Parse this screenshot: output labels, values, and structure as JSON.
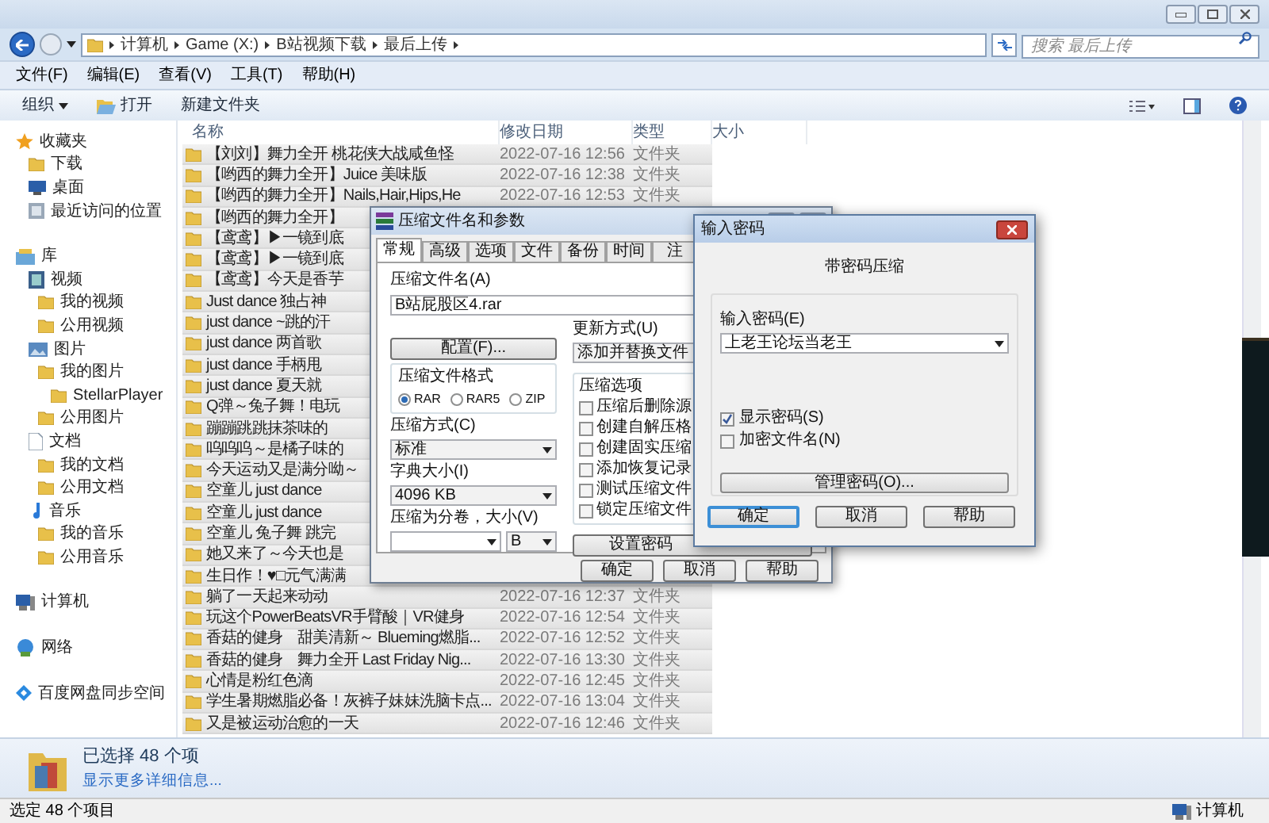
{
  "address_bar": {
    "breadcrumbs": [
      "计算机",
      "Game (X:)",
      "B站视频下载",
      "最后上传"
    ]
  },
  "search": {
    "placeholder": "搜索 最后上传"
  },
  "menu": [
    "文件(F)",
    "编辑(E)",
    "查看(V)",
    "工具(T)",
    "帮助(H)"
  ],
  "toolbar": [
    {
      "label": "组织",
      "kind": "dropdown"
    },
    {
      "label": "打开",
      "kind": "open"
    },
    {
      "label": "新建文件夹",
      "kind": "plain"
    }
  ],
  "sidebar": {
    "items": [
      {
        "label": "收藏夹",
        "kind": "star",
        "children": [
          {
            "label": "下载",
            "kind": "folder"
          },
          {
            "label": "桌面",
            "kind": "desktop"
          },
          {
            "label": "最近访问的位置",
            "kind": "recent"
          }
        ]
      },
      {
        "label": "库",
        "kind": "library",
        "children": [
          {
            "label": "视频",
            "kind": "video",
            "children": [
              {
                "label": "我的视频",
                "kind": "folder"
              },
              {
                "label": "公用视频",
                "kind": "folder"
              }
            ]
          },
          {
            "label": "图片",
            "kind": "picture",
            "children": [
              {
                "label": "我的图片",
                "kind": "folder",
                "children": [
                  {
                    "label": "StellarPlayer",
                    "kind": "folder"
                  }
                ]
              },
              {
                "label": "公用图片",
                "kind": "folder"
              }
            ]
          },
          {
            "label": "文档",
            "kind": "document",
            "children": [
              {
                "label": "我的文档",
                "kind": "folder"
              },
              {
                "label": "公用文档",
                "kind": "folder"
              }
            ]
          },
          {
            "label": "音乐",
            "kind": "music",
            "children": [
              {
                "label": "我的音乐",
                "kind": "folder"
              },
              {
                "label": "公用音乐",
                "kind": "folder"
              }
            ]
          }
        ]
      },
      {
        "label": "计算机",
        "kind": "computer"
      },
      {
        "label": "网络",
        "kind": "network"
      },
      {
        "label": "百度网盘同步空间",
        "kind": "diamond"
      }
    ]
  },
  "file_list": {
    "columns": [
      "名称",
      "修改日期",
      "类型",
      "大小"
    ],
    "rows": [
      {
        "name": "【刘刘】舞力全开 桃花侠大战咸鱼怪",
        "modified": "2022-07-16 12:56",
        "type": "文件夹",
        "selected": true
      },
      {
        "name": "【哟西的舞力全开】Juice 美味版",
        "modified": "2022-07-16 12:38",
        "type": "文件夹",
        "selected": true
      },
      {
        "name": "【哟西的舞力全开】Nails,Hair,Hips,He",
        "modified": "2022-07-16 12:53",
        "type": "文件夹",
        "selected": true
      },
      {
        "name": "【哟西的舞力全开】",
        "selected": true
      },
      {
        "name": "【鸢鸢】▶一镜到底",
        "selected": true
      },
      {
        "name": "【鸢鸢】▶一镜到底",
        "selected": true
      },
      {
        "name": "【鸢鸢】今天是香芋",
        "selected": true
      },
      {
        "name": "Just dance 独占神",
        "selected": true
      },
      {
        "name": "just dance ~跳的汗",
        "selected": true
      },
      {
        "name": "just dance 两首歌",
        "selected": true
      },
      {
        "name": "just dance 手柄甩",
        "selected": true
      },
      {
        "name": "just dance 夏天就",
        "selected": true
      },
      {
        "name": "Q弹～兔子舞！电玩",
        "selected": true
      },
      {
        "name": "蹦蹦跳跳抹茶味的",
        "selected": true
      },
      {
        "name": "呜呜呜～是橘子味的",
        "selected": true
      },
      {
        "name": "今天运动又是满分呦～",
        "selected": true
      },
      {
        "name": "空童儿 just dance",
        "selected": true
      },
      {
        "name": "空童儿 just dance",
        "selected": true
      },
      {
        "name": "空童儿 兔子舞 跳完",
        "selected": true
      },
      {
        "name": "她又来了～今天也是",
        "selected": true
      },
      {
        "name": "生日作！♥□元气满满",
        "selected": true
      },
      {
        "name": "躺了一天起来动动",
        "modified": "2022-07-16 12:37",
        "type": "文件夹",
        "selected": true
      },
      {
        "name": "玩这个PowerBeatsVR手臂酸｜VR健身",
        "modified": "2022-07-16 12:54",
        "type": "文件夹",
        "selected": true
      },
      {
        "name": "香菇的健身　甜美清新～ Blueming燃脂...",
        "modified": "2022-07-16 12:52",
        "type": "文件夹",
        "selected": true
      },
      {
        "name": "香菇的健身　舞力全开 Last Friday Nig...",
        "modified": "2022-07-16 13:30",
        "type": "文件夹",
        "selected": true
      },
      {
        "name": "心情是粉红色滴",
        "modified": "2022-07-16 12:45",
        "type": "文件夹",
        "selected": true
      },
      {
        "name": "学生暑期燃脂必备！灰裤子妹妹洗脑卡点...",
        "modified": "2022-07-16 13:04",
        "type": "文件夹",
        "selected": true
      },
      {
        "name": "又是被运动治愈的一天",
        "modified": "2022-07-16 12:46",
        "type": "文件夹",
        "selected": true
      }
    ]
  },
  "details_pane": {
    "title": "已选择 48 个项",
    "link": "显示更多详细信息..."
  },
  "status_bar": {
    "left": "选定 48 个项目",
    "right": "计算机"
  },
  "archive_dialog": {
    "title": "压缩文件名和参数",
    "tabs": [
      {
        "label": "常规",
        "selected": true
      },
      {
        "label": "高级",
        "selected": false
      },
      {
        "label": "选项",
        "selected": false
      },
      {
        "label": "文件",
        "selected": false
      },
      {
        "label": "备份",
        "selected": false
      },
      {
        "label": "时间",
        "selected": false
      },
      {
        "label": "注",
        "selected": false
      }
    ],
    "archive_name": {
      "label": "压缩文件名(A)",
      "value": "B站屁股区4.rar"
    },
    "update_mode": {
      "label": "更新方式(U)",
      "value": "添加并替换文件"
    },
    "profiles_button": "配置(F)...",
    "format": {
      "label": "压缩文件格式",
      "options": [
        {
          "label": "RAR",
          "selected": true
        },
        {
          "label": "RAR5",
          "selected": false
        },
        {
          "label": "ZIP",
          "selected": false
        }
      ]
    },
    "method": {
      "label": "压缩方式(C)",
      "value": "标准"
    },
    "dictionary": {
      "label": "字典大小(I)",
      "value": "4096 KB"
    },
    "split": {
      "label": "压缩为分卷，大小(V)",
      "unit": "B"
    },
    "options": {
      "label": "压缩选项",
      "items": [
        {
          "label": "压缩后删除源",
          "checked": false
        },
        {
          "label": "创建自解压格",
          "checked": false
        },
        {
          "label": "创建固实压缩",
          "checked": false
        },
        {
          "label": "添加恢复记录",
          "checked": false
        },
        {
          "label": "测试压缩文件",
          "checked": false
        },
        {
          "label": "锁定压缩文件",
          "checked": false
        }
      ]
    },
    "password_button": "设置密码",
    "buttons": [
      "确定",
      "取消",
      "帮助"
    ]
  },
  "password_dialog": {
    "title": "输入密码",
    "subtitle": "带密码压缩",
    "password": {
      "label": "输入密码(E)",
      "value": "上老王论坛当老王"
    },
    "options": [
      {
        "label": "显示密码(S)",
        "checked": true
      },
      {
        "label": "加密文件名(N)",
        "checked": false
      }
    ],
    "manage_button": "管理密码(O)...",
    "buttons": [
      {
        "label": "确定",
        "default": true
      },
      {
        "label": "取消",
        "default": false
      },
      {
        "label": "帮助",
        "default": false
      }
    ]
  }
}
